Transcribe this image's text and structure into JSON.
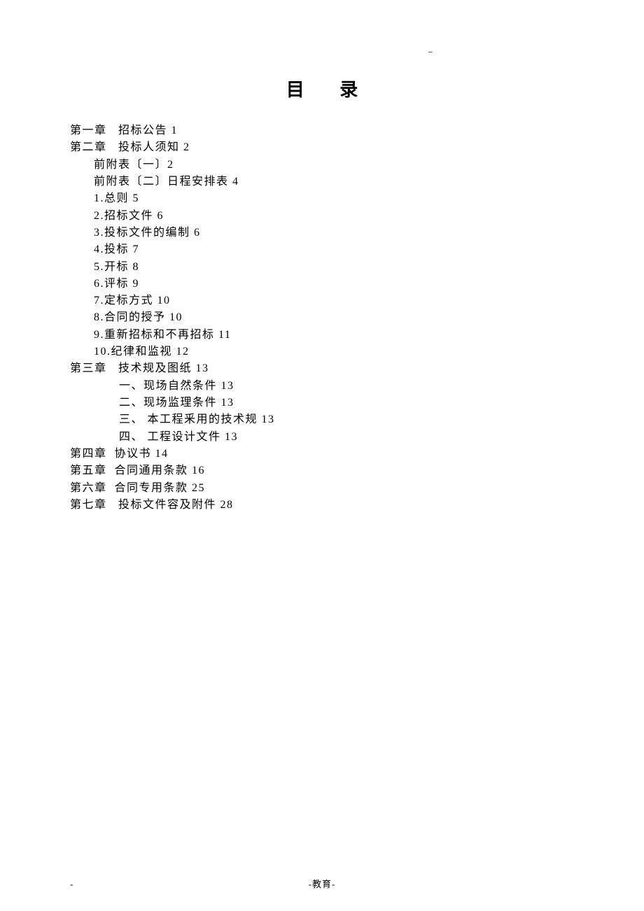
{
  "header_mark": "--",
  "title": "目 录",
  "toc": [
    {
      "level": 0,
      "text": "第一章   招标公告 1"
    },
    {
      "level": 0,
      "text": "第二章   投标人须知 2"
    },
    {
      "level": 1,
      "text": "前附表〔一〕2"
    },
    {
      "level": 1,
      "text": "前附表〔二〕日程安排表 4"
    },
    {
      "level": 1,
      "text": "1.总则 5"
    },
    {
      "level": 1,
      "text": "2.招标文件 6"
    },
    {
      "level": 1,
      "text": "3.投标文件的编制 6"
    },
    {
      "level": 1,
      "text": "4.投标 7"
    },
    {
      "level": 1,
      "text": "5.开标 8"
    },
    {
      "level": 1,
      "text": "6.评标 9"
    },
    {
      "level": 1,
      "text": "7.定标方式 10"
    },
    {
      "level": 1,
      "text": "8.合同的授予 10"
    },
    {
      "level": 1,
      "text": "9.重新招标和不再招标 11"
    },
    {
      "level": 1,
      "text": "10.纪律和监视 12"
    },
    {
      "level": 0,
      "text": "第三章   技术规及图纸 13"
    },
    {
      "level": 2,
      "text": "一、现场自然条件 13"
    },
    {
      "level": 2,
      "text": "二、现场监理条件 13"
    },
    {
      "level": 2,
      "text": "三、 本工程釆用的技术规 13"
    },
    {
      "level": 2,
      "text": "四、 工程设计文件 13"
    },
    {
      "level": 0,
      "text": "第四章  协议书 14"
    },
    {
      "level": 0,
      "text": "第五章  合同通用条款 16"
    },
    {
      "level": 0,
      "text": "第六章  合同专用条款 25"
    },
    {
      "level": 0,
      "text": "第七章   投标文件容及附件 28"
    }
  ],
  "footer_dash": "-",
  "footer_text": "-教育-"
}
